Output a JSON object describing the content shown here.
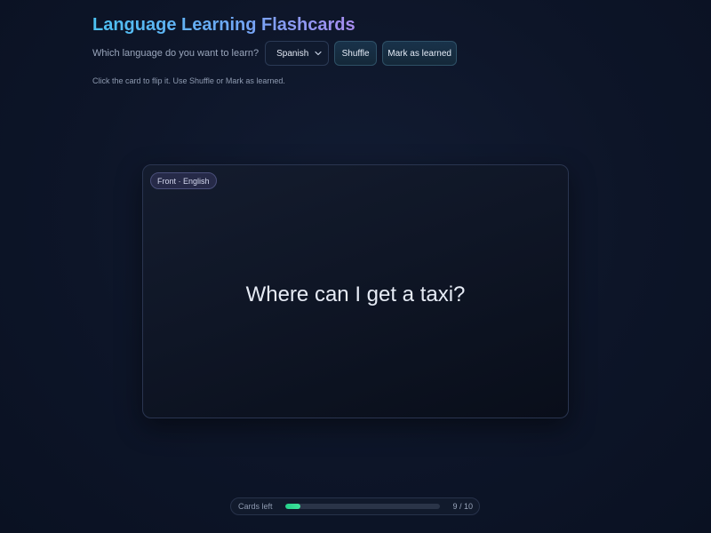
{
  "app": {
    "title": "Language Learning Flashcards"
  },
  "controls": {
    "language_label": "Which language do you want to learn?",
    "language_selected": "Spanish",
    "shuffle_label": "Shuffle",
    "mark_learned_label": "Mark as learned"
  },
  "hint": "Click the card to flip it. Use Shuffle or Mark as learned.",
  "card": {
    "side_badge": "Front · English",
    "text": "Where can I get a taxi?"
  },
  "progress": {
    "label": "Cards left",
    "count_text": "9 / 10",
    "learned_fraction": 0.1
  },
  "icons": {
    "select_chevron": "chevron-down-icon"
  },
  "colors": {
    "accent_green": "#2fd68f",
    "title_gradient_start": "#4cc2f2",
    "title_gradient_end": "#a98cf0",
    "background": "#0d1528"
  }
}
